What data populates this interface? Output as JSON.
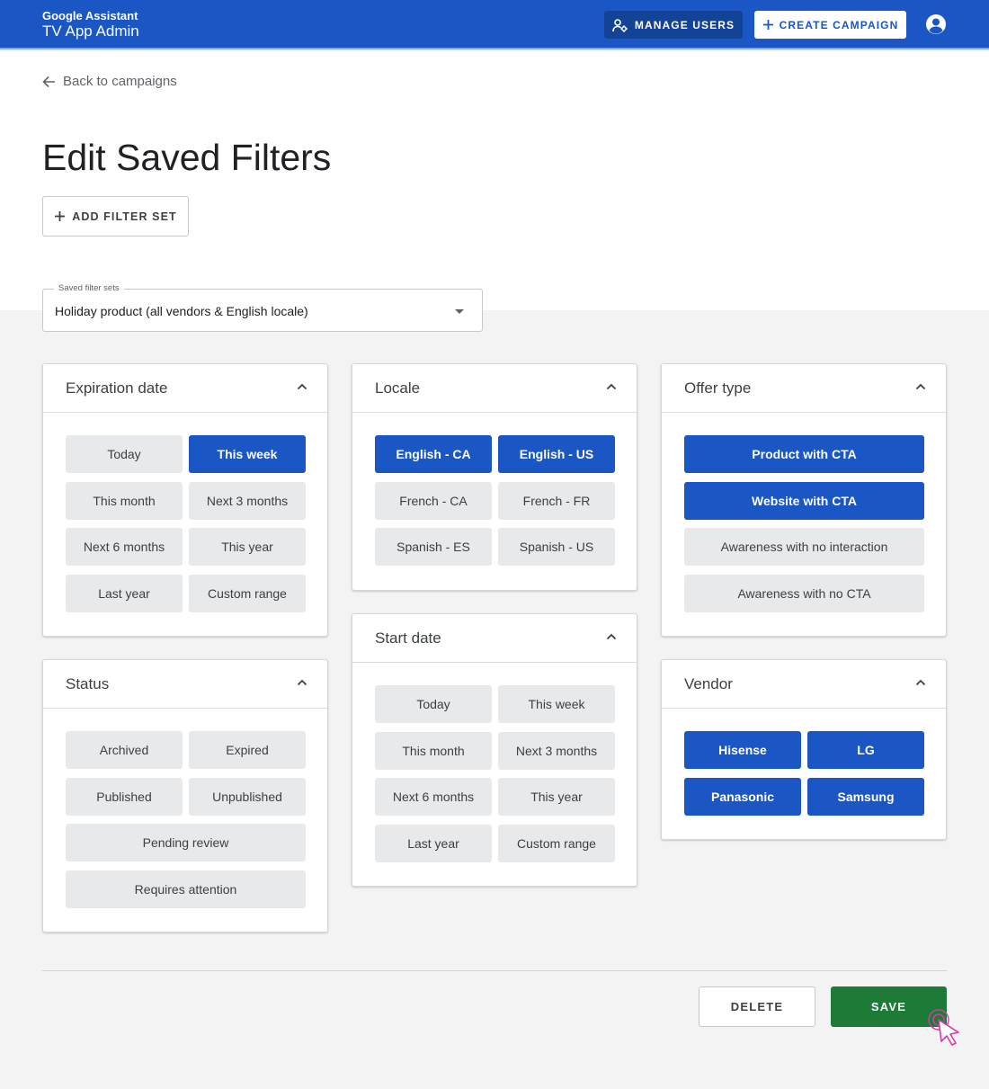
{
  "header": {
    "brand_line1": "Google Assistant",
    "brand_line2": "TV App Admin",
    "manage_users": "MANAGE USERS",
    "create_campaign": "CREATE CAMPAIGN",
    "colors": {
      "bar": "#1a56c4",
      "accent": "#1a56c4",
      "save": "#1e7a37"
    }
  },
  "nav": {
    "back": "Back to campaigns"
  },
  "page": {
    "title": "Edit Saved Filters",
    "add_filter_set": "ADD FILTER SET"
  },
  "saved_sets": {
    "label": "Saved filter sets",
    "value": "Holiday product (all vendors & English locale)"
  },
  "cards": {
    "expiration": {
      "title": "Expiration date",
      "chips": [
        {
          "label": "Today",
          "selected": false
        },
        {
          "label": "This week",
          "selected": true
        },
        {
          "label": "This month",
          "selected": false
        },
        {
          "label": "Next 3 months",
          "selected": false
        },
        {
          "label": "Next 6 months",
          "selected": false
        },
        {
          "label": "This year",
          "selected": false
        },
        {
          "label": "Last year",
          "selected": false
        },
        {
          "label": "Custom range",
          "selected": false
        }
      ]
    },
    "status": {
      "title": "Status",
      "chips": [
        {
          "label": "Archived",
          "selected": false
        },
        {
          "label": "Expired",
          "selected": false
        },
        {
          "label": "Published",
          "selected": false
        },
        {
          "label": "Unpublished",
          "selected": false
        },
        {
          "label": "Pending review",
          "selected": false
        },
        {
          "label": "Requires attention",
          "selected": false
        }
      ]
    },
    "locale": {
      "title": "Locale",
      "chips": [
        {
          "label": "English - CA",
          "selected": true
        },
        {
          "label": "English - US",
          "selected": true
        },
        {
          "label": "French - CA",
          "selected": false
        },
        {
          "label": "French - FR",
          "selected": false
        },
        {
          "label": "Spanish - ES",
          "selected": false
        },
        {
          "label": "Spanish - US",
          "selected": false
        }
      ]
    },
    "start": {
      "title": "Start date",
      "chips": [
        {
          "label": "Today",
          "selected": false
        },
        {
          "label": "This week",
          "selected": false
        },
        {
          "label": "This month",
          "selected": false
        },
        {
          "label": "Next 3 months",
          "selected": false
        },
        {
          "label": "Next 6 months",
          "selected": false
        },
        {
          "label": "This year",
          "selected": false
        },
        {
          "label": "Last year",
          "selected": false
        },
        {
          "label": "Custom range",
          "selected": false
        }
      ]
    },
    "offer": {
      "title": "Offer type",
      "chips": [
        {
          "label": "Product with CTA",
          "selected": true
        },
        {
          "label": "Website with CTA",
          "selected": true
        },
        {
          "label": "Awareness with no interaction",
          "selected": false
        },
        {
          "label": "Awareness with no CTA",
          "selected": false
        }
      ]
    },
    "vendor": {
      "title": "Vendor",
      "chips": [
        {
          "label": "Hisense",
          "selected": true
        },
        {
          "label": "LG",
          "selected": true
        },
        {
          "label": "Panasonic",
          "selected": true
        },
        {
          "label": "Samsung",
          "selected": true
        }
      ]
    }
  },
  "footer": {
    "delete": "DELETE",
    "save": "SAVE"
  }
}
